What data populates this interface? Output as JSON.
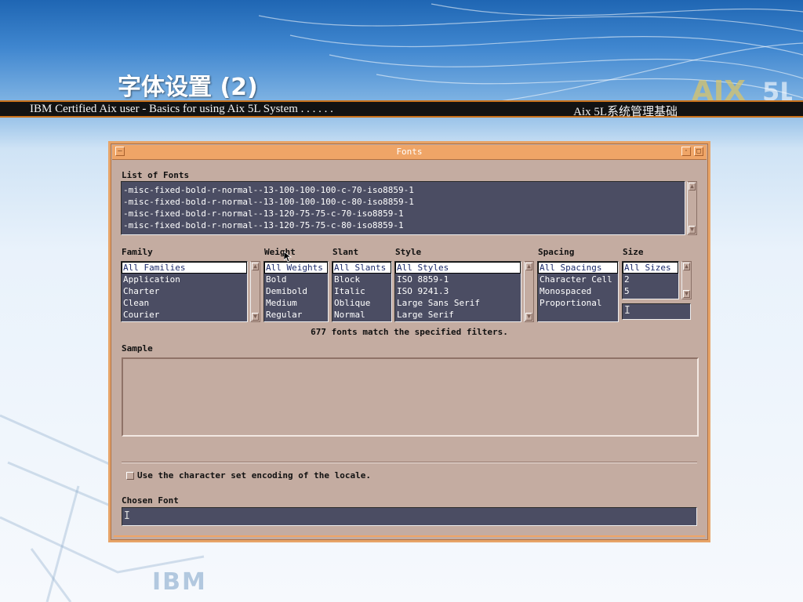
{
  "slide": {
    "title": "字体设置 (2)",
    "header_left": "IBM Certified Aix user - Basics for using Aix 5L System . . . . . .",
    "header_right": "Aix 5L系统管理基础"
  },
  "window": {
    "title": "Fonts",
    "list_of_fonts_label": "List of Fonts",
    "fonts": [
      "-misc-fixed-bold-r-normal--13-100-100-100-c-70-iso8859-1",
      "-misc-fixed-bold-r-normal--13-100-100-100-c-80-iso8859-1",
      "-misc-fixed-bold-r-normal--13-120-75-75-c-70-iso8859-1",
      "-misc-fixed-bold-r-normal--13-120-75-75-c-80-iso8859-1"
    ],
    "filters": {
      "family": {
        "label": "Family",
        "items": [
          "All Families",
          "Application",
          "Charter",
          "Clean",
          "Courier"
        ],
        "selected": 0
      },
      "weight": {
        "label": "Weight",
        "items": [
          "All Weights",
          "Bold",
          "Demibold",
          "Medium",
          "Regular"
        ],
        "selected": 0
      },
      "slant": {
        "label": "Slant",
        "items": [
          "All Slants",
          "Block",
          "Italic",
          "Oblique",
          "Normal"
        ],
        "selected": 0
      },
      "style": {
        "label": "Style",
        "items": [
          "All Styles",
          "ISO 8859-1",
          "ISO 9241.3",
          "Large Sans Serif",
          "Large Serif"
        ],
        "selected": 0
      },
      "spacing": {
        "label": "Spacing",
        "items": [
          "All Spacings",
          "Character Cell",
          "Monospaced",
          "Proportional"
        ],
        "selected": 0
      },
      "size": {
        "label": "Size",
        "items": [
          "All Sizes",
          "2",
          "5"
        ],
        "selected": 0
      }
    },
    "status": "677 fonts match the specified filters.",
    "sample_label": "Sample",
    "checkbox_label": "Use the character set encoding of the locale.",
    "checkbox_checked": false,
    "chosen_font_label": "Chosen Font",
    "chosen_font_value": ""
  },
  "logos": {
    "aix": "AIX 5L",
    "ibm": "IBM"
  }
}
